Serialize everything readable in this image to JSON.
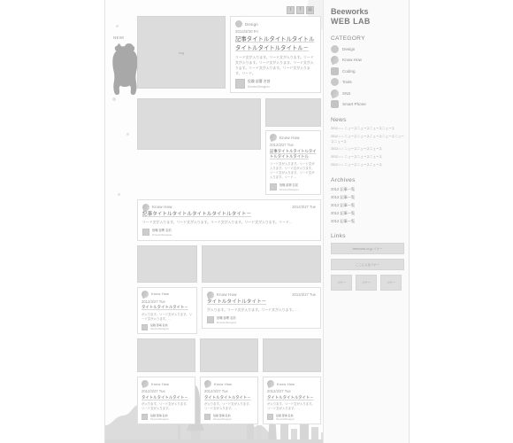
{
  "site": {
    "logo_line1": "Beeworks",
    "logo_line2": "WEB LAB",
    "new_badge": "NEW!"
  },
  "topbar": {
    "social": [
      {
        "name": "twitter-icon",
        "glyph": "t"
      },
      {
        "name": "facebook-icon",
        "glyph": "f"
      },
      {
        "name": "rss-icon",
        "glyph": "▤"
      }
    ]
  },
  "hero": {
    "category": "Design",
    "date": "2012/3/30 Fri",
    "title": "記事タイトルタイトルタイトルタイトルタイトルタイトル－",
    "lead": "リード文が入ります。リード文が入ります。リード文が入ります。リード文が入ります。リード文が入ります。リード文が入ります。リード文が入ります。リード。",
    "image_label": "img",
    "author_name": "役職 部署 名前",
    "author_role": "Director/Designer"
  },
  "cards": [
    {
      "category": "Know How",
      "date": "2012/3/27 Tue",
      "title": "記事タイトルタイトルタイトルタイトルタイト－",
      "lead": "リード文が入ります。リード文が入ります。リード文が入ります。リード文が入ります。リード…",
      "author_name": "役職 部署 名前",
      "author_role": "Director/Designer"
    },
    {
      "category": "Know How",
      "date": "2012/3/27 Tue",
      "title": "タイトルタイトルタイト－",
      "lead": "が入ります。リード文が入ります。リード文が入ります。…",
      "author_name": "役職 部署 名前",
      "author_role": "Director/Designer"
    },
    {
      "category": "Know How",
      "date": "2012/3/27 Tue",
      "title": "タイトルタイトルタイト－",
      "lead": "が入ります。リード文が入ります。リード文が入ります。…",
      "author_name": "役職 部署 名前",
      "author_role": "Director/Designer"
    },
    {
      "category": "Know How",
      "date": "2012/3/27 Tue",
      "title": "記事タイトルタイトルタイトルタイトルタイトル",
      "lead": "リード文が入ります。リード文が入ります。リード文が入ります。リード文が入ります。リード文が入ります。リード…",
      "author_name": "役職 部署 名前",
      "author_role": "Director/Designer"
    },
    {
      "category": "Know How",
      "date": "2012/3/27 Tue",
      "title": "タイトルタイトルタイト－",
      "lead": "が入ります。リード文が入ります。リード文が入ります。…",
      "author_name": "役職 部署 名前",
      "author_role": "Director/Designer"
    },
    {
      "category": "Know How",
      "date": "2012/3/27 Tue",
      "title": "タイトルタイトルタイト－",
      "lead": "が入ります。リード文が入ります。リード文が入ります。…",
      "author_name": "役職 部署 名前",
      "author_role": "Director/Designer"
    },
    {
      "category": "Know How",
      "date": "2012/3/27 Tue",
      "title": "タイトルタイトルタイト－",
      "lead": "が入ります。リード文が入ります。リード文が入ります。…",
      "author_name": "役職 部署 名前",
      "author_role": "Director/Designer"
    }
  ],
  "sidebar": {
    "category": {
      "title": "CATEGORY",
      "items": [
        {
          "label": "Design",
          "icon": "circle-icon"
        },
        {
          "label": "Know How",
          "icon": "meteor-icon"
        },
        {
          "label": "Coding",
          "icon": "gear-icon"
        },
        {
          "label": "Tools",
          "icon": "circle-icon"
        },
        {
          "label": "SNS",
          "icon": "meteor-icon"
        },
        {
          "label": "Smart Phone",
          "icon": "gear-icon"
        }
      ]
    },
    "news": {
      "title": "News",
      "items": [
        "2012.○.○ ニュースニュースニュースニュース",
        "2012.○.○ ニュースニュースニュースニュースニュースニュース",
        "2012.○.○ ニュースニュースニュース",
        "2012.○.○ ニュースニュースニュース",
        "2012.○.○ ニュースニュースニュース"
      ]
    },
    "archives": {
      "title": "Archives",
      "items": [
        "2012 記事一覧",
        "2012 記事一覧",
        "2012 記事一覧",
        "2012 記事一覧",
        "2012 記事一覧"
      ]
    },
    "links": {
      "title": "Links",
      "banners": [
        "beeworks.co.jp バナー",
        "ここに入るバナー"
      ],
      "small_banners": [
        "バナー",
        "バナー",
        "バナー"
      ]
    }
  },
  "colors": {
    "page_bg": "#ffffff",
    "site_bg": "#fdfdfd",
    "sidebar_bg": "#fafafa",
    "thumb": "#dcdcdc",
    "border": "#e0e0e0",
    "text": "#8e8e8e",
    "city": "#dcdcdc"
  }
}
